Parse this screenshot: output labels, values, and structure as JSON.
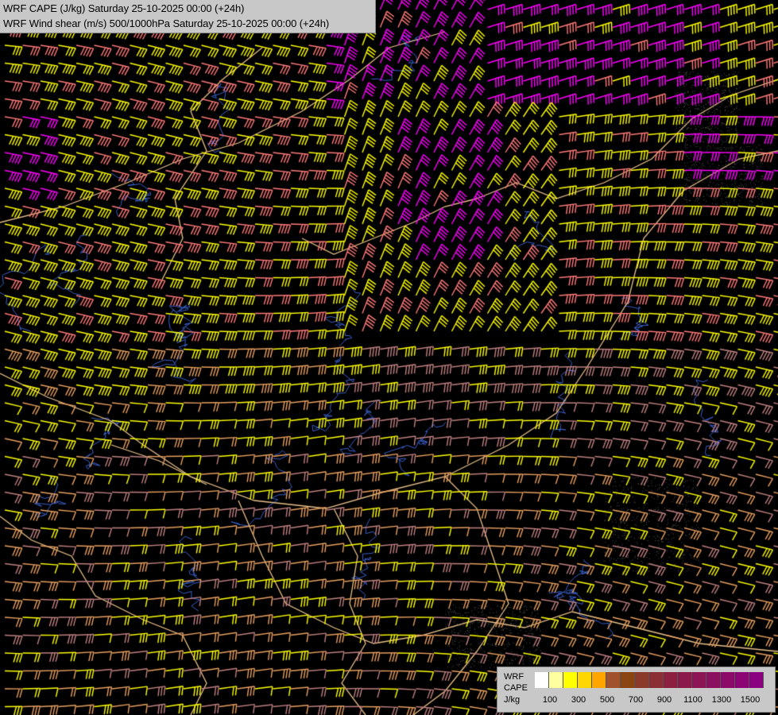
{
  "header": {
    "title_line1": "WRF CAPE (J/kg) Saturday 25-10-2025 00:00 (+24h)",
    "title_line2": "WRF Wind shear (m/s) 500/1000hPa Saturday 25-10-2025 00:00 (+24h)"
  },
  "legend": {
    "model_label": "WRF",
    "field_label": "CAPE",
    "unit_label": "J/kg",
    "swatch_colors": [
      "#ffffff",
      "#ffffa0",
      "#ffff00",
      "#ffd700",
      "#ffa500",
      "#a0522d",
      "#8b4513",
      "#8b3a2a",
      "#8b2f35",
      "#8b2040",
      "#8b1a4a",
      "#8b1555",
      "#8b1060",
      "#8b0a6a",
      "#8b0575",
      "#8b0080"
    ],
    "ticks": [
      "100",
      "300",
      "500",
      "700",
      "900",
      "1100",
      "1300",
      "1500"
    ]
  },
  "colors": {
    "background": "#000000",
    "borders": "#e8c08a",
    "rivers": "#3a5fc8",
    "barb_yellow": "#ffff00",
    "barb_magenta": "#ff00ff",
    "barb_salmon": "#ff7a7a",
    "barb_tan": "#e8a060",
    "barb_pink": "#c08080"
  }
}
